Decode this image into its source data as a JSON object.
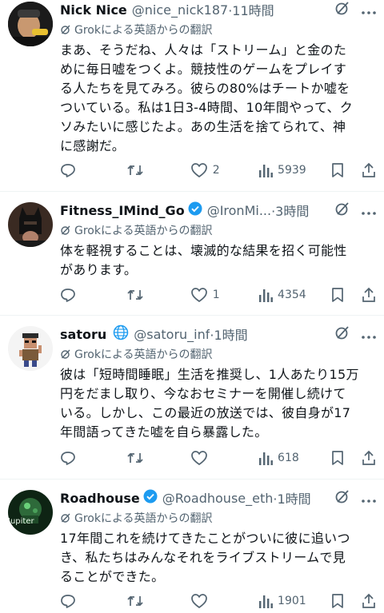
{
  "tweets": [
    {
      "name": "Nick Nice",
      "handle": "@nice_nick187",
      "time": "·11時間",
      "translation": "Grokによる英語からの翻訳",
      "lines": [
        "まあ、そうだね、人々は「ストリーム」と金のた",
        "めに毎日嘘をつくよ。競技性のゲームをプレイす",
        "る人たちを見てみろ。彼らの80%はチートか嘘を",
        "ついている。私は1日3-4時間、10年間やって、ク",
        "ソみたいに感じたよ。あの生活を捨てられて、神",
        "に感謝だ。"
      ],
      "likes": "2",
      "views": "5939",
      "verified": false
    },
    {
      "name": "Fitness_IMind_Go",
      "handle": "@IronMi...",
      "time": "·3時間",
      "translation": "Grokによる英語からの翻訳",
      "lines": [
        "体を軽視することは、壊滅的な結果を招く可能性",
        "があります。"
      ],
      "likes": "1",
      "views": "4354",
      "verified": true
    },
    {
      "name": "satoru",
      "handle": "@satoru_inf",
      "time": "·1時間",
      "translation": "Grokによる英語からの翻訳",
      "lines": [
        "彼は「短時間睡眠」生活を推奨し、1人あたり15万",
        "円をだまし取り、今なおセミナーを開催し続けて",
        "いる。しかし、この最近の放送では、彼自身が17",
        "年間語ってきた嘘を自ら暴露した。"
      ],
      "likes": "",
      "views": "618",
      "verified": false
    },
    {
      "name": "Roadhouse",
      "handle": "@Roadhouse_eth",
      "time": "·1時間",
      "translation": "Grokによる英語からの翻訳",
      "lines": [
        "17年間これを続けてきたことがついに彼に追いつ",
        "き、私たちはみんなそれをライブストリームで見",
        "ることができた。"
      ],
      "likes": "",
      "views": "1901",
      "verified": true
    }
  ],
  "avatars": {
    "t0": "Nick Nice avatar",
    "t1": "Fitness avatar",
    "t2": "satoru avatar",
    "t3": "Roadhouse avatar",
    "t3_text": "Jupiter"
  },
  "colors": {
    "verified": "#1d9bf0",
    "muted": "#536471",
    "text": "#0f1419"
  }
}
